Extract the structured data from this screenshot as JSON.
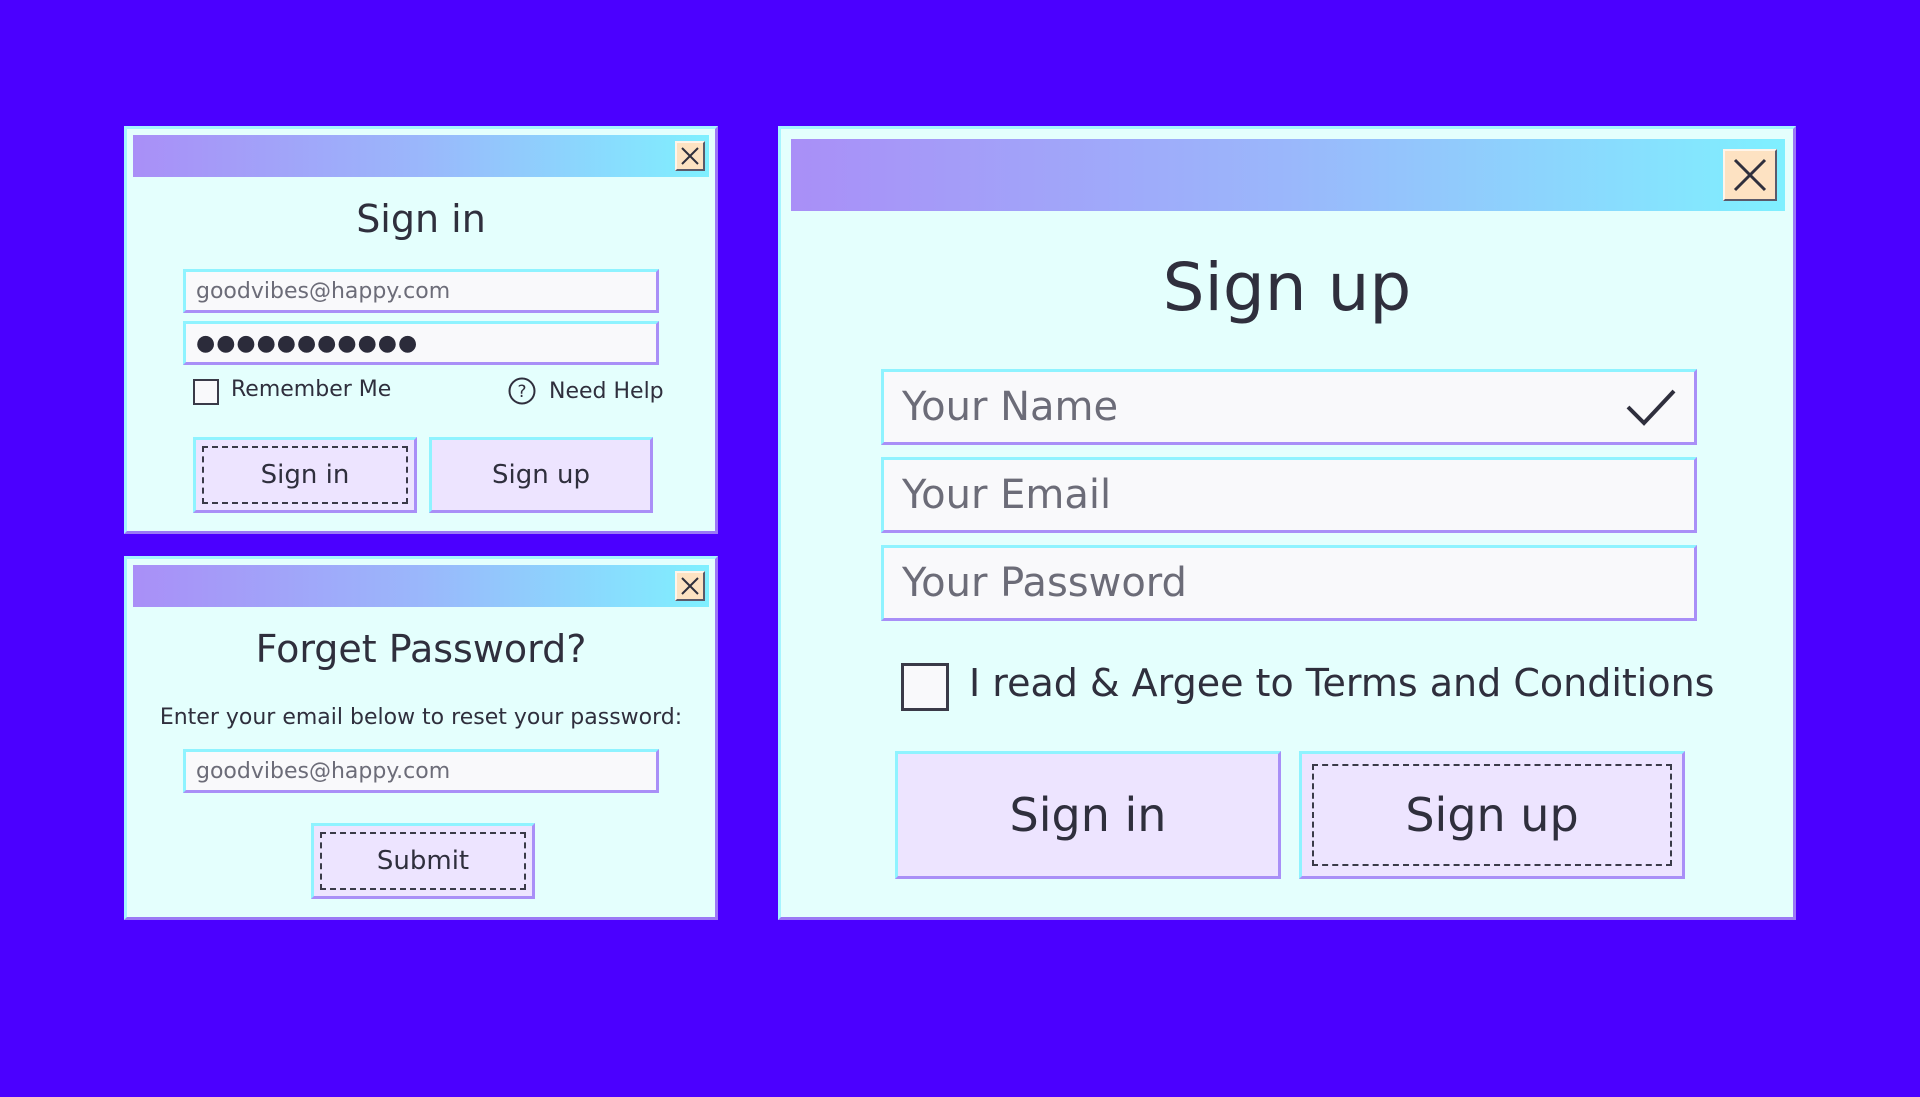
{
  "colors": {
    "background": "#4b00ff",
    "window_bg": "#e4fffd",
    "titlebar_start": "#a98ff7",
    "titlebar_end": "#7ff0ff",
    "button_bg": "#ede4ff",
    "close_bg": "#fde2c2"
  },
  "signin": {
    "title": "Sign in",
    "email_value": "goodvibes@happy.com",
    "password_value": "●●●●●●●●●●●",
    "remember_label": "Remember Me",
    "remember_checked": false,
    "help_icon": "question-circle-icon",
    "help_label": "Need Help",
    "signin_button": "Sign in",
    "signup_button": "Sign up"
  },
  "forgot": {
    "title": "Forget Password?",
    "instruction": "Enter your email below to reset your password:",
    "email_value": "goodvibes@happy.com",
    "submit_button": "Submit"
  },
  "signup": {
    "title": "Sign up",
    "name_placeholder": "Your Name",
    "name_valid_icon": "checkmark-icon",
    "email_placeholder": "Your Email",
    "password_placeholder": "Your Password",
    "terms_label": "I read & Argee to Terms and Conditions",
    "terms_checked": false,
    "signin_button": "Sign in",
    "signup_button": "Sign up"
  },
  "icons": {
    "close": "close-icon"
  }
}
